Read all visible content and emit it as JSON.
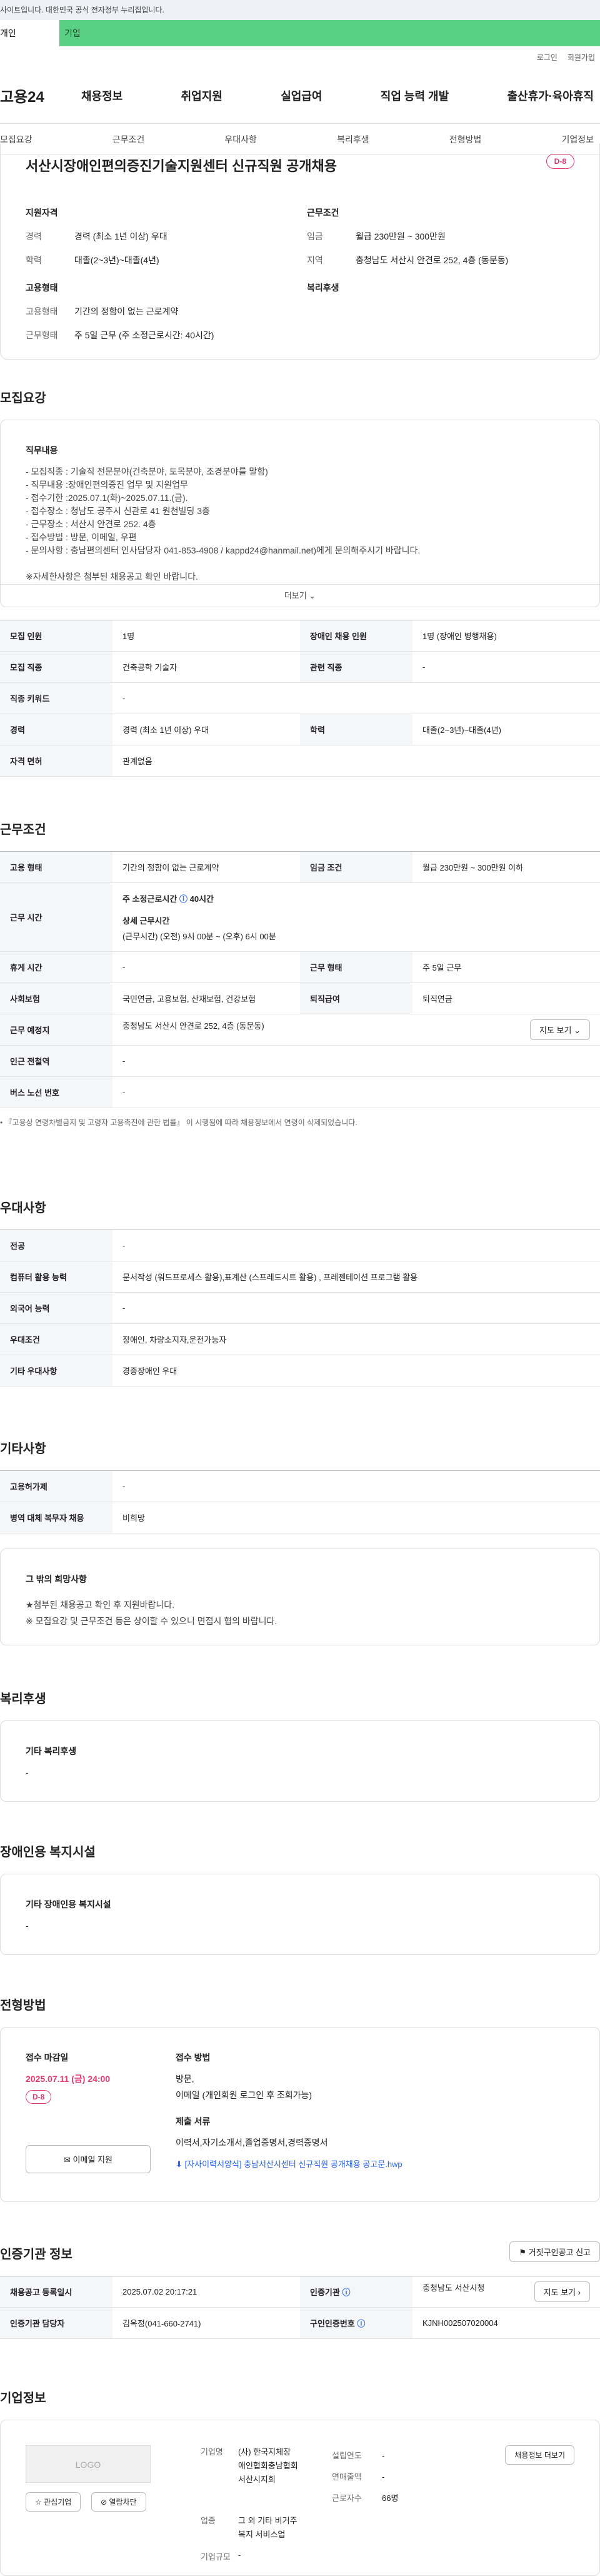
{
  "topbar": {
    "notice": "사이트입니다. 대한민국 공식 전자정부 누리집입니다."
  },
  "tabs": {
    "t1": "개인",
    "t2": "기업"
  },
  "util": {
    "login": "로그인",
    "join": "회원가입"
  },
  "gnb": {
    "logo": "고용24",
    "items": [
      "채용정보",
      "취업지원",
      "실업급여",
      "직업 능력 개발",
      "출산휴가·육아휴직"
    ]
  },
  "lnb": [
    "모집요강",
    "근무조건",
    "우대사항",
    "복리후생",
    "전형방법",
    "기업정보"
  ],
  "summary": {
    "title": "서산시장애인편의증진기술지원센터 신규직원 공개채용",
    "dday": "D-8",
    "qual": {
      "heading": "지원자격",
      "career_k": "경력",
      "career_v": "경력 (최소 1년 이상) 우대",
      "edu_k": "학력",
      "edu_v": "대졸(2~3년)~대졸(4년)"
    },
    "cond": {
      "heading": "근무조건",
      "pay_k": "임금",
      "pay_v": "월급 230만원 ~ 300만원",
      "area_k": "지역",
      "area_v": "충청남도 서산시 안견로 252, 4층 (동문동)"
    },
    "form": {
      "heading": "고용형태",
      "type_k": "고용형태",
      "type_v": "기간의 정함이 없는 근로계약",
      "hours_k": "근무형태",
      "hours_v": "주 5일 근무 (주 소정근로시간: 40시간)"
    },
    "welfare": {
      "heading": "복리후생"
    }
  },
  "recruit": {
    "heading": "모집요강",
    "duty_heading": "직무내용",
    "lines": [
      "- 모집직종 : 기술직 전문분야(건축분야, 토목분야, 조경분야를 말함)",
      "- 직무내용 :장애인편의증진 업무 및 지원업무",
      "- 접수기한 :2025.07.1(화)~2025.07.11.(금).",
      "- 접수장소 : 청남도 공주시 신관로 41 원천빌딩 3층",
      "- 근무장소 : 서산시 안견로 252. 4층",
      "- 접수방법 : 방문, 이메일, 우편",
      "- 문의사항 : 충남편의센터 인사담당자 041-853-4908 / kappd24@hanmail.net)에게 문의해주시기 바랍니다.",
      "",
      "※자세한사항은 첨부된 채용공고 확인 바랍니다."
    ],
    "more": "더보기",
    "rows": [
      [
        "모집 인원",
        "1명",
        "장애인 채용 인원",
        "1명 (장애인 병행채용)"
      ],
      [
        "모집 직종",
        "건축공학 기술자",
        "관련 직종",
        "-"
      ],
      [
        "직종 키워드",
        "-",
        "",
        ""
      ],
      [
        "경력",
        "경력 (최소 1년 이상) 우대",
        "학력",
        "대졸(2~3년)~대졸(4년)"
      ],
      [
        "자격 면허",
        "관계없음",
        "",
        ""
      ]
    ]
  },
  "work": {
    "heading": "근무조건",
    "r1": [
      "고용 형태",
      "기간의 정함이 없는 근로계약",
      "임금 조건",
      "월급 230만원 ~ 300만원 이하"
    ],
    "hours_k": "근무 시간",
    "hours_a": "주 소정근로시간",
    "hours_b": "40시간",
    "hours_c": "상세 근무시간",
    "hours_d": "(근무시간) (오전) 9시 00분 ~ (오후) 6시 00분",
    "r3": [
      "휴게 시간",
      "-",
      "근무 형태",
      "주 5일 근무"
    ],
    "r4": [
      "사회보험",
      "국민연금, 고용보험, 산재보험, 건강보험",
      "퇴직급여",
      "퇴직연금"
    ],
    "addr_k": "근무 예정지",
    "addr_v": "충청남도 서산시 안견로 252, 4층 (동문동)",
    "map": "지도 보기",
    "r6": [
      "인근 전철역",
      "-"
    ],
    "r7": [
      "버스 노선 번호",
      "-"
    ],
    "note": "• 『고용상 연령차별금지 및 고령자 고용촉진에 관한 법률』 이 시행됨에 따라 채용정보에서 연령이 삭제되었습니다."
  },
  "pref": {
    "heading": "우대사항",
    "rows": [
      [
        "전공",
        "-"
      ],
      [
        "컴퓨터 활용 능력",
        "문서작성 (워드프로세스 활용),표계산 (스프레드시트 활용) , 프레젠테이션 프로그램 활용"
      ],
      [
        "외국어 능력",
        "-"
      ],
      [
        "우대조건",
        "장애인, 차량소지자,운전가능자"
      ],
      [
        "기타 우대사항",
        "경증장애인 우대"
      ]
    ]
  },
  "etc": {
    "heading": "기타사항",
    "rows": [
      [
        "고용허가제",
        "-"
      ],
      [
        "병역 대체 복무자 채용",
        "비희망"
      ]
    ],
    "box_title": "그 밖의 희망사항",
    "box_l1": "★첨부된 채용공고 확인 후 지원바랍니다.",
    "box_l2": "※ 모집요강 및 근무조건 등은 상이할 수 있으니 면접시 협의 바랍니다."
  },
  "welfare": {
    "heading": "복리후생",
    "sub": "기타 복리후생",
    "val": "-"
  },
  "disab": {
    "heading": "장애인용 복지시설",
    "sub": "기타 장애인용 복지시설",
    "val": "-"
  },
  "screen": {
    "heading": "전형방법",
    "deadline_k": "접수 마감일",
    "deadline_v": "2025.07.11 (금) 24:00",
    "dday": "D-8",
    "email_btn": "이메일 지원",
    "method_k": "접수 방법",
    "method_v1": "방문,",
    "method_v2": "이메일 (개인회원 로그인 후 조회가능)",
    "docs_k": "제출 서류",
    "docs_v": "이력서,자기소개서,졸업증명서,경력증명서",
    "file": "[자사이력서양식] 충남서산시센터 신규직원 공개채용 공고문.hwp"
  },
  "cert": {
    "heading": "인증기관 정보",
    "origin": "거짓구인공고 신고",
    "r1": [
      "채용공고 등록일시",
      "2025.07.02 20:17:21",
      "인증기관",
      "충청남도 서산시청",
      "지도 보기"
    ],
    "r2": [
      "인증기관 담당자",
      "김옥정(041-660-2741)",
      "구인인증번호",
      "KJNH002507020004"
    ]
  },
  "company": {
    "heading": "기업정보",
    "logo": "LOGO",
    "fav": "관심기업",
    "block": "열람차단",
    "name_k": "기업명",
    "name_v1": "(사) 한국지체장",
    "name_v2": "애인협회충남협회",
    "name_v3": "서산시지회",
    "found_k": "설립연도",
    "found_v": "-",
    "sales_k": "연매출액",
    "sales_v": "-",
    "emp_k": "근로자수",
    "emp_v": "66명",
    "ind_k": "업종",
    "ind_v1": "그 외 기타 비거주",
    "ind_v2": "복지 서비스업",
    "size_k": "기업규모",
    "size_v": "-",
    "list_btn": "채용정보 더보기"
  }
}
